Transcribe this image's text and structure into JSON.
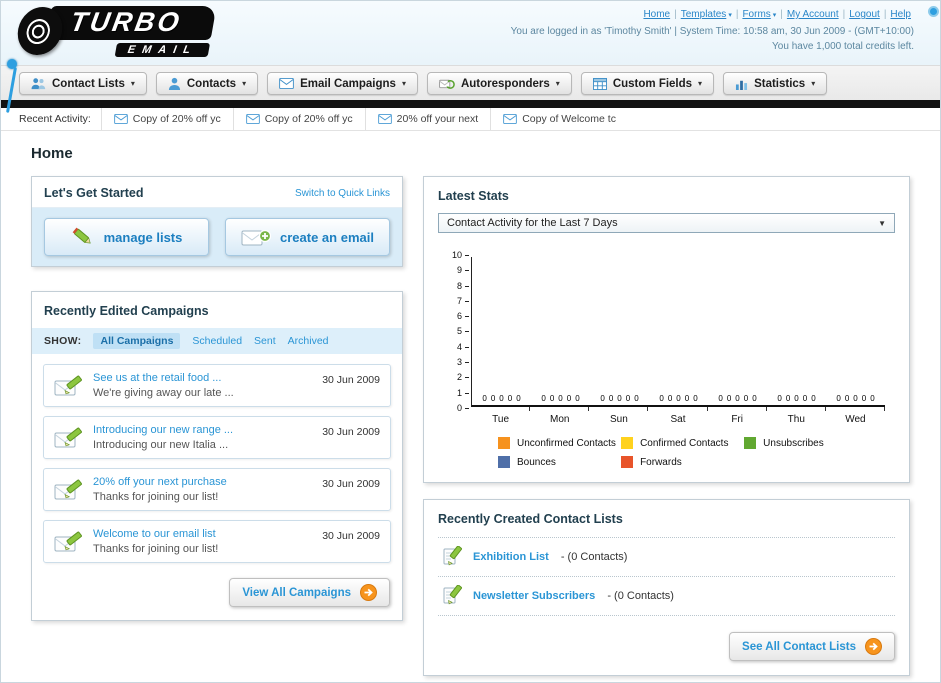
{
  "header": {
    "logo_line1": "TURBO",
    "logo_line2": "EMAIL",
    "nav_links": [
      {
        "label": "Home",
        "caret": false
      },
      {
        "label": "Templates",
        "caret": true
      },
      {
        "label": "Forms",
        "caret": true
      },
      {
        "label": "My Account",
        "caret": false
      },
      {
        "label": "Logout",
        "caret": false
      },
      {
        "label": "Help",
        "caret": false
      }
    ],
    "login_info": "You are logged in as 'Timothy Smith' | System Time: 10:58 am, 30 Jun 2009 - (GMT+10:00)",
    "credits": "You have 1,000 total credits left."
  },
  "nav_tabs": [
    {
      "label": "Contact Lists",
      "icon": "contact-lists-icon"
    },
    {
      "label": "Contacts",
      "icon": "contacts-icon"
    },
    {
      "label": "Email Campaigns",
      "icon": "email-campaigns-icon"
    },
    {
      "label": "Autoresponders",
      "icon": "autoresponders-icon"
    },
    {
      "label": "Custom Fields",
      "icon": "custom-fields-icon"
    },
    {
      "label": "Statistics",
      "icon": "statistics-icon"
    }
  ],
  "recent_activity": {
    "label": "Recent Activity:",
    "items": [
      "Copy of 20% off yc",
      "Copy of 20% off yc",
      "20% off your next",
      "Copy of Welcome tc"
    ]
  },
  "page_title": "Home",
  "get_started": {
    "title": "Let's Get Started",
    "switch_link": "Switch to Quick Links",
    "manage_lists_label": "manage lists",
    "create_email_label": "create an email"
  },
  "campaigns": {
    "title": "Recently Edited Campaigns",
    "show_label": "SHOW:",
    "filters": [
      {
        "label": "All Campaigns",
        "active": true
      },
      {
        "label": "Scheduled",
        "active": false
      },
      {
        "label": "Sent",
        "active": false
      },
      {
        "label": "Archived",
        "active": false
      }
    ],
    "items": [
      {
        "title": "See us at the retail food ...",
        "subtitle": "We're giving away our late ...",
        "date": "30 Jun 2009"
      },
      {
        "title": "Introducing our new range ...",
        "subtitle": "Introducing our new Italia ...",
        "date": "30 Jun 2009"
      },
      {
        "title": "20% off your next purchase",
        "subtitle": "Thanks for joining our list!",
        "date": "30 Jun 2009"
      },
      {
        "title": "Welcome to our email list",
        "subtitle": "Thanks for joining our list!",
        "date": "30 Jun 2009"
      }
    ],
    "view_all_label": "View All Campaigns"
  },
  "latest_stats": {
    "title": "Latest Stats",
    "dropdown_value": "Contact Activity for the Last 7 Days"
  },
  "chart_data": {
    "type": "bar",
    "title": "Contact Activity for the Last 7 Days",
    "categories": [
      "Tue",
      "Mon",
      "Sun",
      "Sat",
      "Fri",
      "Thu",
      "Wed"
    ],
    "series": [
      {
        "name": "Unconfirmed Contacts",
        "color": "#f6921e",
        "values": [
          0,
          0,
          0,
          0,
          0,
          0,
          0
        ]
      },
      {
        "name": "Confirmed Contacts",
        "color": "#ffd21e",
        "values": [
          0,
          0,
          0,
          0,
          0,
          0,
          0
        ]
      },
      {
        "name": "Unsubscribes",
        "color": "#61a831",
        "values": [
          0,
          0,
          0,
          0,
          0,
          0,
          0
        ]
      },
      {
        "name": "Bounces",
        "color": "#4f6fa8",
        "values": [
          0,
          0,
          0,
          0,
          0,
          0,
          0
        ]
      },
      {
        "name": "Forwards",
        "color": "#e8542a",
        "values": [
          0,
          0,
          0,
          0,
          0,
          0,
          0
        ]
      }
    ],
    "ylim": [
      0,
      10
    ],
    "ytick_step": 1,
    "xlabel": "",
    "ylabel": "",
    "grid": false,
    "legend_position": "bottom"
  },
  "contact_lists": {
    "title": "Recently Created Contact Lists",
    "items": [
      {
        "name": "Exhibition List",
        "detail": "- (0 Contacts)"
      },
      {
        "name": "Newsletter Subscribers",
        "detail": "- (0 Contacts)"
      }
    ],
    "see_all_label": "See All Contact Lists"
  }
}
